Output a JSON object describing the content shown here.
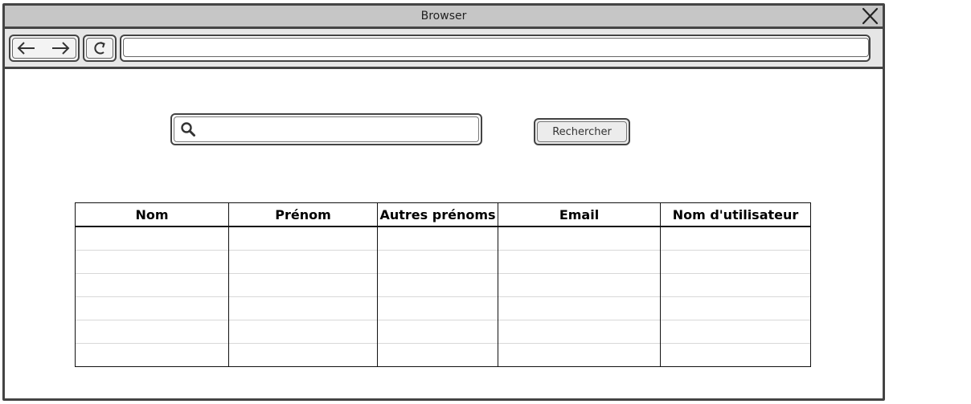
{
  "window": {
    "title": "Browser"
  },
  "toolbar": {
    "address_value": ""
  },
  "search": {
    "placeholder": "",
    "value": "",
    "button_label": "Rechercher"
  },
  "table": {
    "columns": [
      "Nom",
      "Prénom",
      "Autres prénoms",
      "Email",
      "Nom d'utilisateur"
    ],
    "row_count": 6
  },
  "icons": {
    "close": "close-icon",
    "back": "arrow-left-icon",
    "forward": "arrow-right-icon",
    "reload": "reload-icon",
    "search": "search-icon"
  },
  "colors": {
    "titlebar": "#c6c6c6",
    "toolbar": "#e6e6e6",
    "border": "#444444",
    "button": "#ececec"
  }
}
